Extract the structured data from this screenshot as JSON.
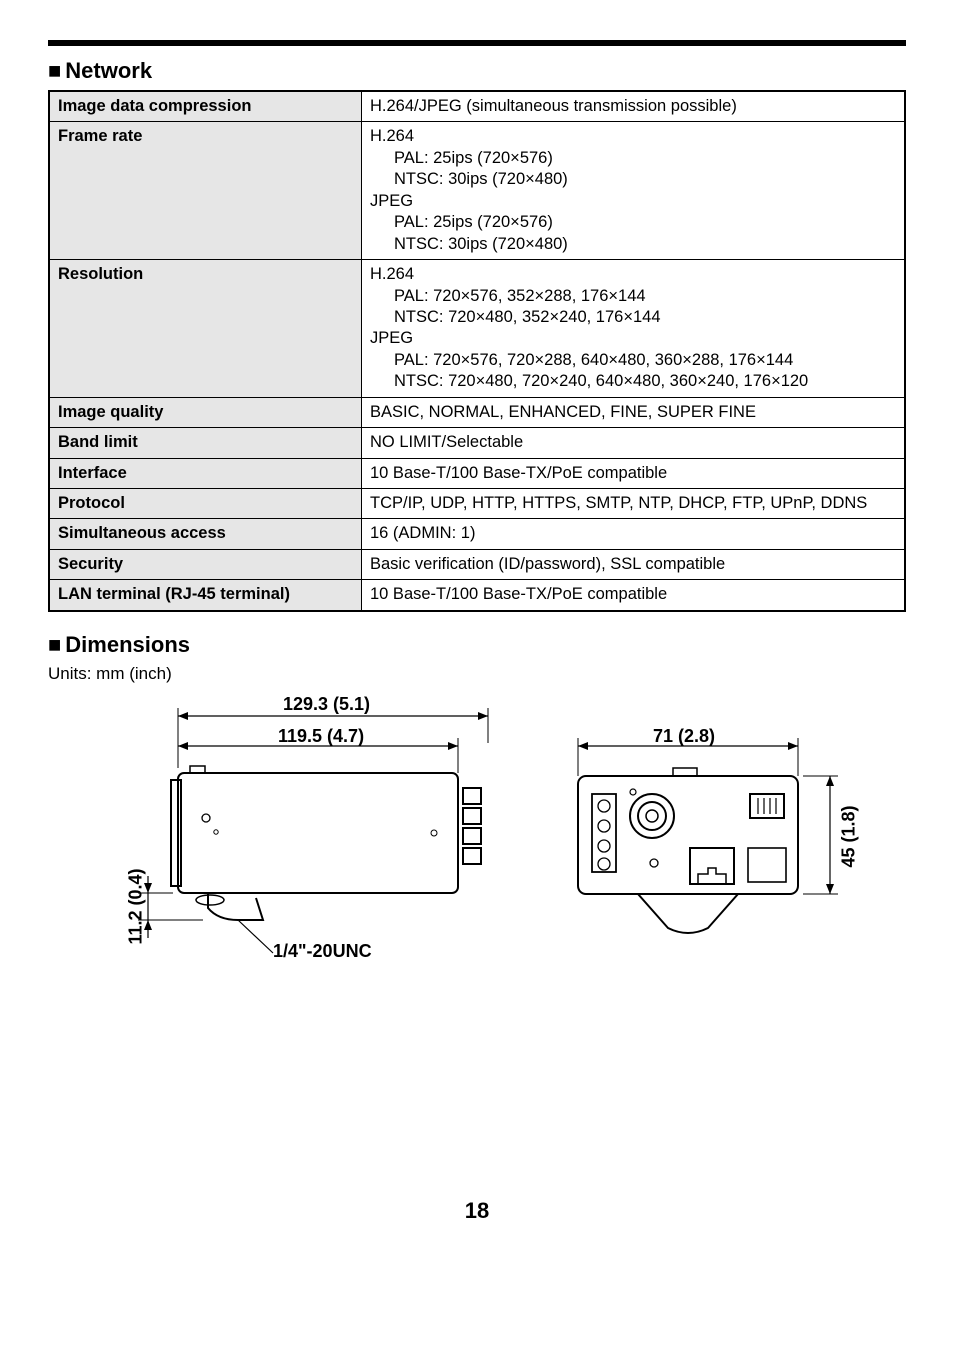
{
  "sections": {
    "network_heading": "Network",
    "dimensions_heading": "Dimensions",
    "units_note": "Units: mm (inch)"
  },
  "network_table": {
    "image_data_compression": {
      "label": "Image data compression",
      "value": "H.264/JPEG (simultaneous transmission possible)"
    },
    "frame_rate": {
      "label": "Frame rate",
      "h264_label": "H.264",
      "h264_pal": "PAL: 25ips (720×576)",
      "h264_ntsc": "NTSC: 30ips (720×480)",
      "jpeg_label": "JPEG",
      "jpeg_pal": "PAL: 25ips (720×576)",
      "jpeg_ntsc": "NTSC: 30ips (720×480)"
    },
    "resolution": {
      "label": "Resolution",
      "h264_label": "H.264",
      "h264_pal": "PAL: 720×576, 352×288, 176×144",
      "h264_ntsc": "NTSC: 720×480, 352×240, 176×144",
      "jpeg_label": "JPEG",
      "jpeg_pal": "PAL: 720×576, 720×288, 640×480, 360×288, 176×144",
      "jpeg_ntsc": "NTSC: 720×480, 720×240, 640×480, 360×240, 176×120"
    },
    "image_quality": {
      "label": "Image quality",
      "value": "BASIC, NORMAL, ENHANCED, FINE, SUPER FINE"
    },
    "band_limit": {
      "label": "Band limit",
      "value": "NO LIMIT/Selectable"
    },
    "interface": {
      "label": "Interface",
      "value": "10 Base-T/100 Base-TX/PoE compatible"
    },
    "protocol": {
      "label": "Protocol",
      "value": "TCP/IP, UDP, HTTP, HTTPS, SMTP, NTP, DHCP, FTP, UPnP, DDNS"
    },
    "simultaneous_access": {
      "label": "Simultaneous access",
      "value": "16 (ADMIN: 1)"
    },
    "security": {
      "label": "Security",
      "value": "Basic verification (ID/password), SSL compatible"
    },
    "lan_terminal": {
      "label": "LAN terminal (RJ-45 terminal)",
      "value": "10 Base-T/100 Base-TX/PoE compatible"
    }
  },
  "dimensions": {
    "width_outer": "129.3 (5.1)",
    "width_inner": "119.5 (4.7)",
    "depth": "71 (2.8)",
    "height_side": "45 (1.8)",
    "height_bottom": "11.2 (0.4)",
    "thread": "1/4\"-20UNC"
  },
  "page_number": "18"
}
